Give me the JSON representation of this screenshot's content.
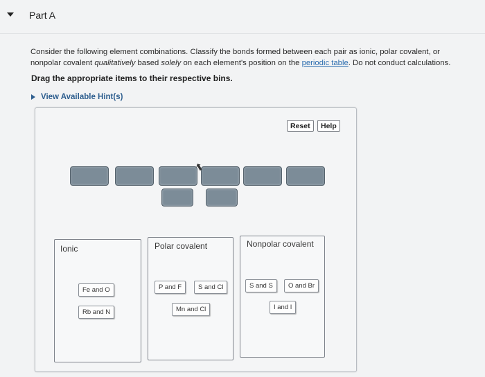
{
  "part": {
    "title": "Part A"
  },
  "instructions": {
    "line1": "Consider the following element combinations. Classify the bonds formed between each pair as ionic, polar covalent, or",
    "line2_a": "nonpolar covalent ",
    "line2_b": "qualitatively",
    "line2_c": " based ",
    "line2_d": "solely",
    "line2_e": " on each element's position on the ",
    "line2_link": "periodic table",
    "line2_f": ". Do not conduct calculations.",
    "drag_note": "Drag the appropriate items to their respective bins.",
    "hint_label": "View Available Hint(s)"
  },
  "toolbar": {
    "reset_label": "Reset",
    "help_label": "Help"
  },
  "bins": {
    "ionic": {
      "label": "Ionic",
      "items": [
        "Fe and O",
        "Rb and N"
      ]
    },
    "polar": {
      "label": "Polar covalent",
      "items": [
        "P and F",
        "S and Cl",
        "Mn and Cl"
      ]
    },
    "nonpolar": {
      "label": "Nonpolar covalent",
      "items": [
        "S and S",
        "O and Br",
        "I and I"
      ]
    }
  }
}
